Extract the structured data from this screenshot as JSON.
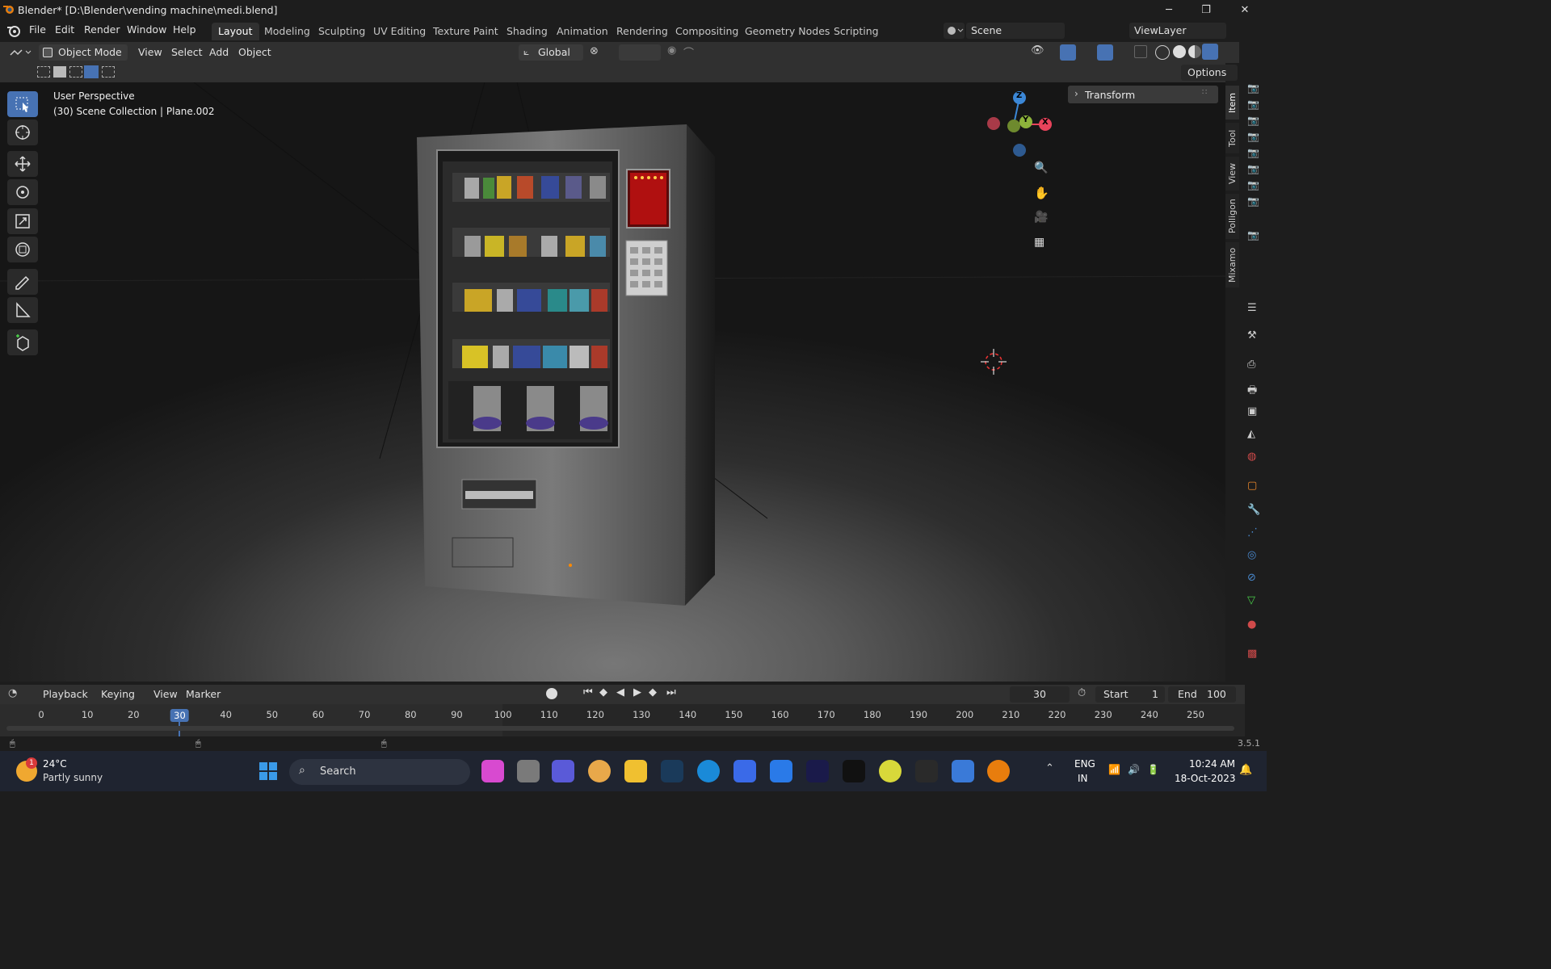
{
  "window": {
    "title": "Blender* [D:\\Blender\\vending machine\\medi.blend]",
    "minimize": "─",
    "maximize": "❐",
    "close": "✕"
  },
  "menu": [
    "File",
    "Edit",
    "Render",
    "Window",
    "Help"
  ],
  "workspaces": [
    "Layout",
    "Modeling",
    "Sculpting",
    "UV Editing",
    "Texture Paint",
    "Shading",
    "Animation",
    "Rendering",
    "Compositing",
    "Geometry Nodes",
    "Scripting"
  ],
  "active_workspace": "Layout",
  "scene": {
    "name": "Scene",
    "view_layer": "ViewLayer"
  },
  "header": {
    "mode": "Object Mode",
    "menus": [
      "View",
      "Select",
      "Add",
      "Object"
    ],
    "transform_orientation": "Global",
    "options_label": "Options"
  },
  "viewport": {
    "perspective_label": "User Perspective",
    "collection_label": "(30) Scene Collection | Plane.002",
    "gizmo": {
      "z": "Z",
      "x": "X",
      "y": "Y"
    }
  },
  "n_panel": {
    "transform_label": "Transform",
    "tabs": [
      "Item",
      "Tool",
      "View",
      "Polligon",
      "Mixamo"
    ],
    "active_tab": "Item"
  },
  "timeline": {
    "menus": [
      "Playback",
      "Keying",
      "View",
      "Marker"
    ],
    "current_frame": "30",
    "start_label": "Start",
    "start": "1",
    "end_label": "End",
    "end": "100",
    "ticks": [
      "0",
      "10",
      "20",
      "30",
      "40",
      "50",
      "60",
      "70",
      "80",
      "90",
      "100",
      "110",
      "120",
      "130",
      "140",
      "150",
      "160",
      "170",
      "180",
      "190",
      "200",
      "210",
      "220",
      "230",
      "240",
      "250"
    ]
  },
  "version": "3.5.1",
  "taskbar": {
    "weather_temp": "24°C",
    "weather_desc": "Partly sunny",
    "weather_badge": "1",
    "search_placeholder": "Search",
    "lang": "ENG",
    "region": "IN",
    "time": "10:24 AM",
    "date": "18-Oct-2023"
  },
  "colors": {
    "accent": "#4772b3",
    "x_axis": "#e8435b",
    "y_axis": "#8db33b",
    "z_axis": "#3b87d6"
  }
}
